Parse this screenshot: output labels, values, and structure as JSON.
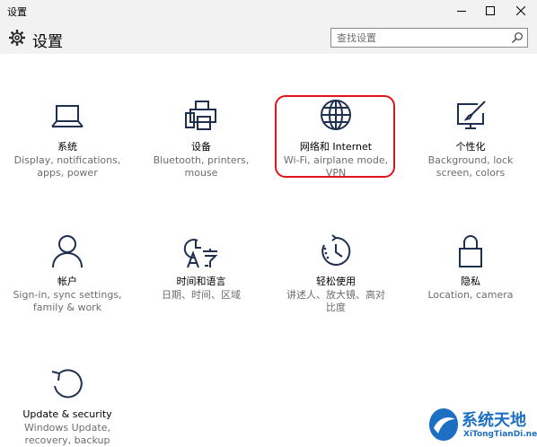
{
  "window": {
    "title": "设置"
  },
  "header": {
    "title": "设置",
    "search_placeholder": "查找设置"
  },
  "tiles": [
    {
      "label": "系统",
      "desc": [
        "Display, notifications,",
        "apps, power"
      ],
      "icon": "laptop-icon"
    },
    {
      "label": "设备",
      "desc": [
        "Bluetooth, printers,",
        "mouse"
      ],
      "icon": "printer-keyboard-icon"
    },
    {
      "label": "网络和 Internet",
      "desc": [
        "Wi-Fi, airplane mode,",
        "VPN"
      ],
      "icon": "globe-icon"
    },
    {
      "label": "个性化",
      "desc": [
        "Background, lock",
        "screen, colors"
      ],
      "icon": "paint-monitor-icon"
    },
    {
      "label": "帐户",
      "desc": [
        "Sign-in, sync settings,",
        "family & work"
      ],
      "icon": "person-icon"
    },
    {
      "label": "时间和语言",
      "desc": [
        "日期、时间、区域"
      ],
      "icon": "time-language-icon"
    },
    {
      "label": "轻松使用",
      "desc": [
        "讲述人、放大镜、高对",
        "比度"
      ],
      "icon": "ease-of-access-icon"
    },
    {
      "label": "隐私",
      "desc": [
        "Location, camera"
      ],
      "icon": "lock-icon"
    },
    {
      "label": "Update & security",
      "desc": [
        "Windows Update,",
        "recovery, backup"
      ],
      "icon": "refresh-icon"
    }
  ],
  "watermark": {
    "title": "系统天地",
    "url": "XiTongTianDi.net"
  },
  "colors": {
    "chrome_bg": "#f2f2f2",
    "icon_navy": "#1f2f4f",
    "desc_gray": "#6d6d6d",
    "highlight_red": "#e0141c",
    "watermark_blue": "#1d6fc4"
  }
}
